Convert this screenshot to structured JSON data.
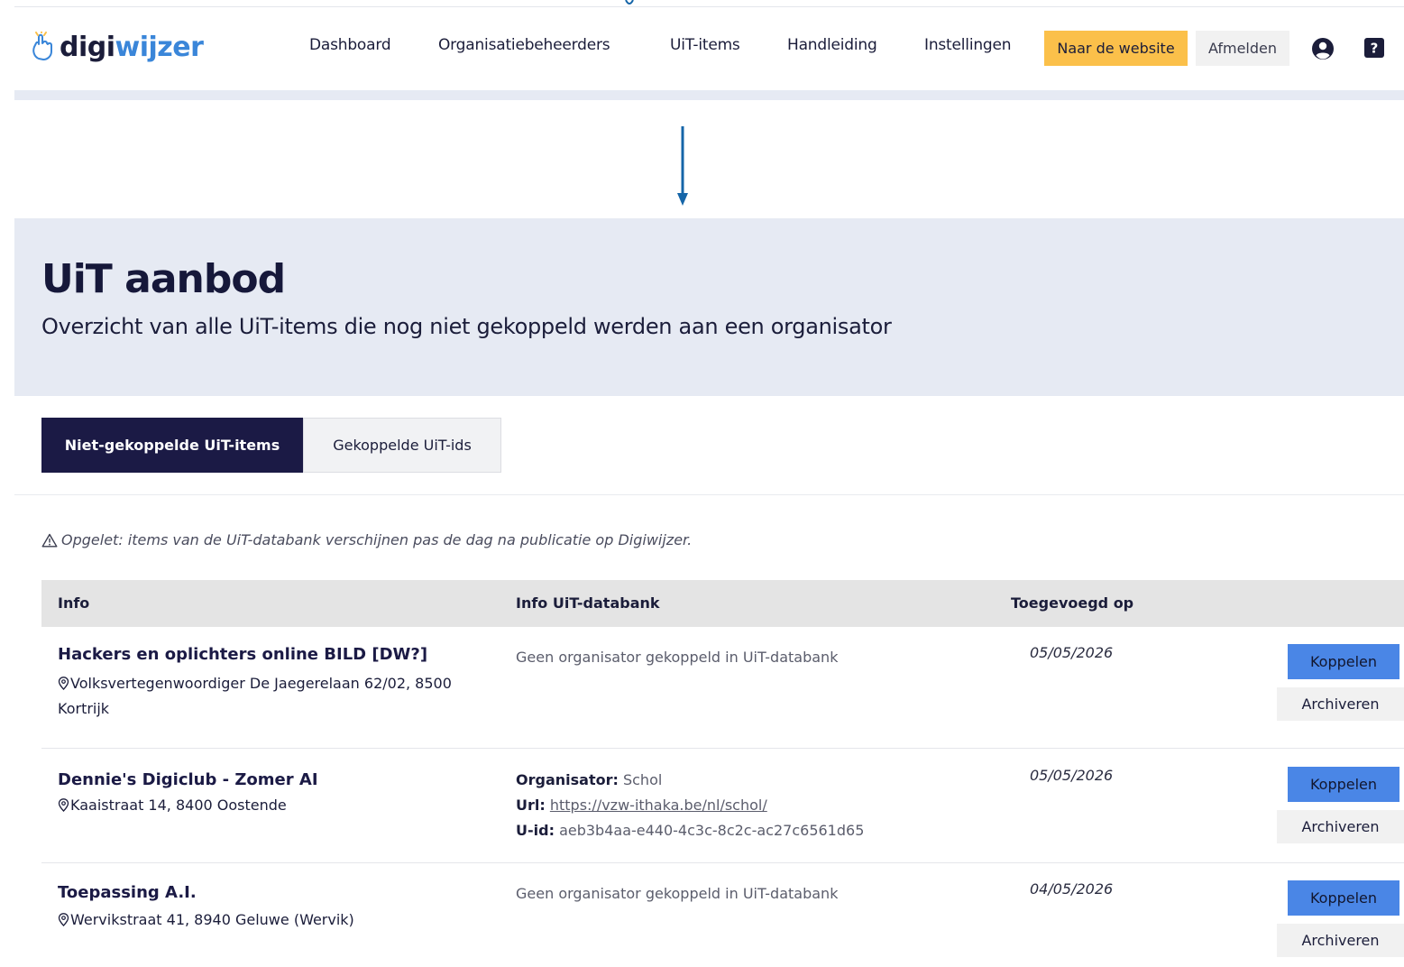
{
  "brand": {
    "name_prefix": "digi",
    "name_suffix": "wijzer",
    "accent_color": "#3a86d9",
    "dark_color": "#1b1a45"
  },
  "nav": {
    "items": [
      {
        "label": "Dashboard"
      },
      {
        "label": "Organisatiebeheerders"
      },
      {
        "label": "UiT-items"
      },
      {
        "label": "Handleiding"
      },
      {
        "label": "Instellingen"
      }
    ],
    "website_button": "Naar de website",
    "logout_button": "Afmelden",
    "user_icon": "user-circle-icon",
    "help_icon": "question-square-icon",
    "website_button_color": "#fbc04a"
  },
  "hero": {
    "title": "UiT aanbod",
    "subtitle": "Overzicht van alle UiT-items die nog niet gekoppeld werden aan een organisator"
  },
  "tabs": [
    {
      "label": "Niet-gekoppelde UiT-items",
      "active": true
    },
    {
      "label": "Gekoppelde UiT-ids",
      "active": false
    }
  ],
  "notice": "Opgelet: items van de UiT-databank verschijnen pas de dag na publicatie op Digiwijzer.",
  "table": {
    "headers": {
      "info": "Info",
      "uit": "Info UiT-databank",
      "added": "Toegevoegd op"
    },
    "rows": [
      {
        "title": "Hackers en oplichters online BILD [DW?]",
        "address": "Volksvertegenwoordiger De Jaegerelaan 62/02, 8500 Kortrijk",
        "uit_text": "Geen organisator gekoppeld in UiT-databank",
        "date": "05/05/2026",
        "link_button": "Koppelen",
        "archive_button": "Archiveren"
      },
      {
        "title": "Dennie's Digiclub - Zomer AI",
        "address": "Kaaistraat 14, 8400 Oostende",
        "organisator_label": "Organisator:",
        "organisator_value": "Schol",
        "url_label": "Url:",
        "url_value": "https://vzw-ithaka.be/nl/schol/",
        "uid_label": "U-id:",
        "uid_value": "aeb3b4aa-e440-4c3c-8c2c-ac27c6561d65",
        "date": "05/05/2026",
        "link_button": "Koppelen",
        "archive_button": "Archiveren"
      },
      {
        "title": "Toepassing A.I.",
        "address": "Wervikstraat 41, 8940 Geluwe (Wervik)",
        "uit_text": "Geen organisator gekoppeld in UiT-databank",
        "date": "04/05/2026",
        "link_button": "Koppelen",
        "archive_button": "Archiveren"
      }
    ]
  }
}
